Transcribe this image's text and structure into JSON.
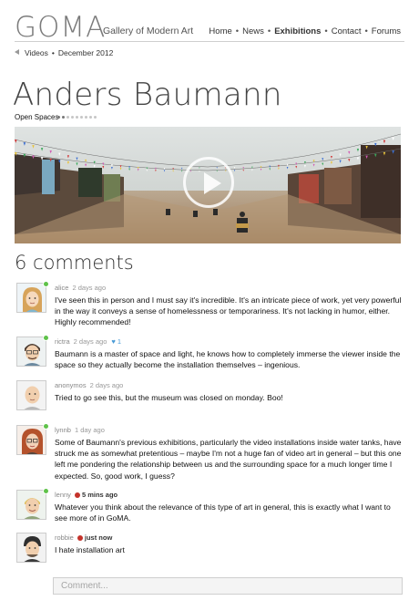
{
  "header": {
    "logo": "GOMA",
    "tagline": "Gallery of Modern Art",
    "nav": [
      {
        "label": "Home",
        "active": false
      },
      {
        "label": "News",
        "active": false
      },
      {
        "label": "Exhibitions",
        "active": true
      },
      {
        "label": "Contact",
        "active": false
      },
      {
        "label": "Forums",
        "active": false
      }
    ]
  },
  "breadcrumb": {
    "items": [
      "Videos",
      "December 2012"
    ]
  },
  "artist": {
    "name": "Anders Baumann",
    "work": "Open Spaces",
    "pager": {
      "total": 9,
      "current": 2
    }
  },
  "video": {
    "icon": "play-icon"
  },
  "comments_section": {
    "count_label": "6 comments",
    "input_placeholder": "Comment..."
  },
  "comments": [
    {
      "name": "alice",
      "time": "2 days ago",
      "online": true,
      "text": "I've seen this in person and I must say it's incredible. It's an intricate piece of work, yet very powerful in the way it conveys a sense of homelessness or temporariness. It's not lacking in humor, either. Highly recommended!"
    },
    {
      "name": "rictra",
      "time": "2 days ago",
      "online": true,
      "likes": "1",
      "text": "Baumann is a master of space and light, he knows how to completely immerse the viewer inside the space so they actually become the installation themselves – ingenious."
    },
    {
      "name": "anonymos",
      "time": "2 days ago",
      "online": false,
      "text": "Tried to go see this, but the museum was closed on monday. Boo!"
    },
    {
      "name": "lynnb",
      "time": "1 day ago",
      "online": true,
      "text": "Some of Baumann's previous exhibitions, particularly the video installations inside water tanks, have struck me as somewhat pretentious – maybe I'm not a huge fan of video art in general – but this one left me pondering the relationship between us and the surrounding space for a much longer time I expected. So, good work, I guess?"
    },
    {
      "name": "lenny",
      "time": "5 mins ago",
      "online": true,
      "new": true,
      "text": "Whatever you think about the relevance of this type of art in general, this is exactly what I want to see more of in GoMA."
    },
    {
      "name": "robbie",
      "time": "just now",
      "online": false,
      "new": true,
      "text": "I hate installation art"
    }
  ],
  "colors": {
    "online": "#5fc24a",
    "new_marker": "#c4322a",
    "like": "#4a9bd6",
    "logo": "#7a7a7a"
  }
}
